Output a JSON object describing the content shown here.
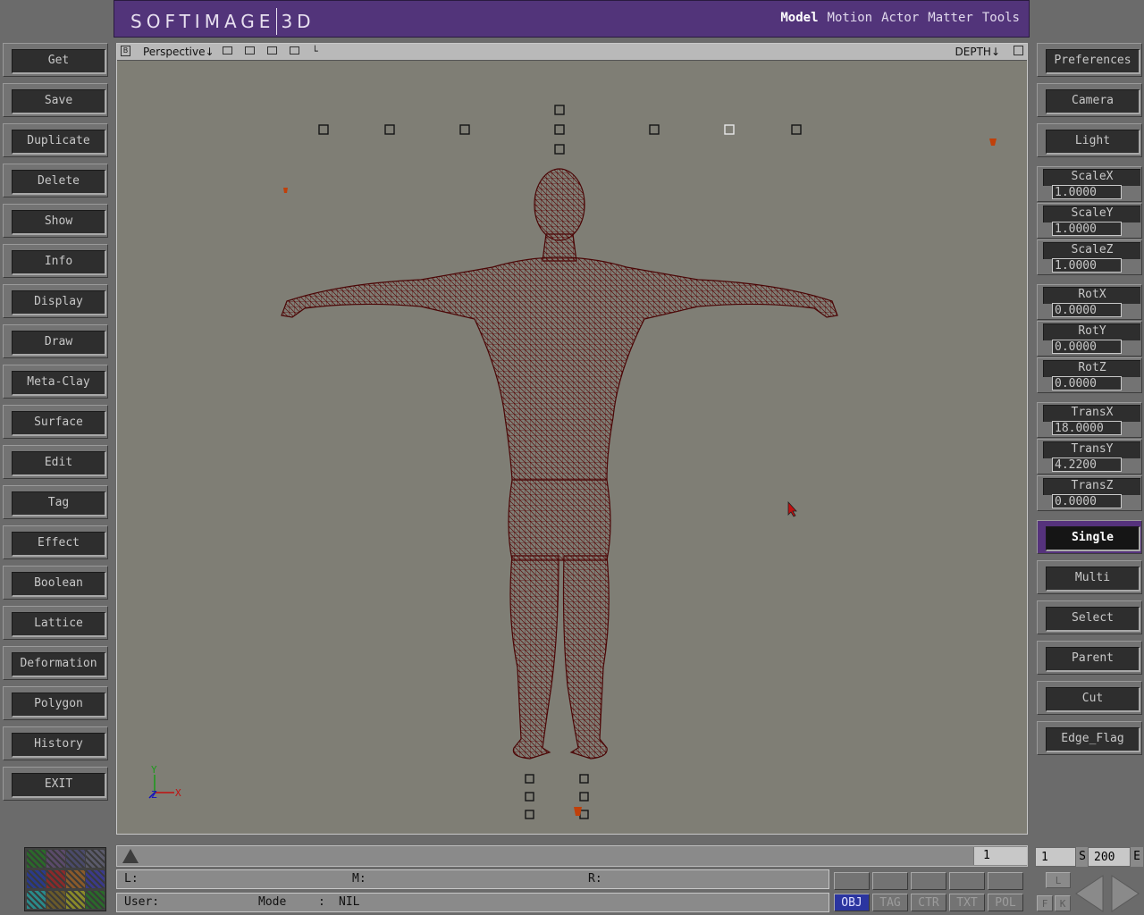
{
  "app": {
    "brand_left": "SOFTIMAGE",
    "brand_right": "3D",
    "modules": [
      "Model",
      "Motion",
      "Actor",
      "Matter",
      "Tools"
    ],
    "active_module": "Model"
  },
  "left_menu": [
    {
      "label": "Get"
    },
    {
      "label": "Save"
    },
    {
      "label": "Duplicate"
    },
    {
      "label": "Delete"
    },
    {
      "label": "Show"
    },
    {
      "label": "Info"
    },
    {
      "label": "Display"
    },
    {
      "label": "Draw"
    },
    {
      "label": "Meta-Clay"
    },
    {
      "label": "Surface"
    },
    {
      "label": "Edit"
    },
    {
      "label": "Tag"
    },
    {
      "label": "Effect"
    },
    {
      "label": "Boolean"
    },
    {
      "label": "Lattice"
    },
    {
      "label": "Deformation"
    },
    {
      "label": "Polygon"
    },
    {
      "label": "History"
    },
    {
      "label": "EXIT"
    }
  ],
  "right_top": [
    "Preferences",
    "Camera",
    "Light"
  ],
  "transforms": {
    "scale": [
      {
        "label": "ScaleX",
        "value": "1.0000"
      },
      {
        "label": "ScaleY",
        "value": "1.0000"
      },
      {
        "label": "ScaleZ",
        "value": "1.0000"
      }
    ],
    "rotate": [
      {
        "label": "RotX",
        "value": "0.0000"
      },
      {
        "label": "RotY",
        "value": "0.0000"
      },
      {
        "label": "RotZ",
        "value": "0.0000"
      }
    ],
    "translate": [
      {
        "label": "TransX",
        "value": "18.0000"
      },
      {
        "label": "TransY",
        "value": "4.2200"
      },
      {
        "label": "TransZ",
        "value": "0.0000"
      }
    ]
  },
  "selection_modes": [
    "Single",
    "Multi",
    "Select",
    "Parent",
    "Cut",
    "Edge_Flag"
  ],
  "active_selection": "Single",
  "viewport": {
    "corner_label": "B",
    "camera": "Perspective↓",
    "depth": "DEPTH↓",
    "axis_labels": {
      "y": "Y",
      "x": "X",
      "z": "Z"
    },
    "wire_color": "#5a0a0a",
    "background": "#7f7e75"
  },
  "timeline": {
    "current_frame": "1"
  },
  "status": {
    "left": "L:",
    "middle": "M:",
    "right": "R:",
    "user": "User:",
    "mode_label": "Mode",
    "mode_sep": ":",
    "mode_value": "NIL"
  },
  "mode_buttons": [
    "OBJ",
    "TAG",
    "CTR",
    "TXT",
    "POL"
  ],
  "active_mode": "OBJ",
  "frames": {
    "start": "1",
    "start_tag": "S",
    "end": "200",
    "end_tag": "E"
  },
  "key_buttons": {
    "l": "L",
    "f": "F",
    "k": "K"
  }
}
